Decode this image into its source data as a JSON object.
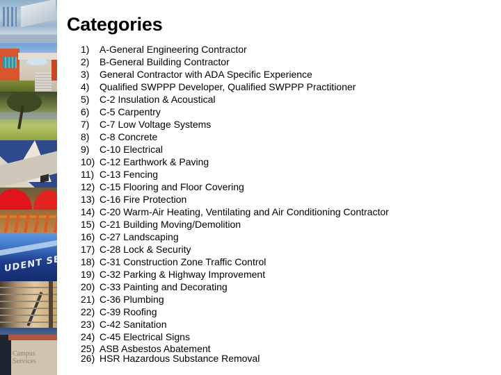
{
  "slide": {
    "title": "Categories",
    "photo_strip": [
      {
        "name": "glass-building-photo"
      },
      {
        "name": "orange-building-photo"
      },
      {
        "name": "trees-lawn-photo"
      },
      {
        "name": "white-tent-roof-photo"
      },
      {
        "name": "red-umbrellas-photo"
      },
      {
        "name": "services-sign-photo",
        "text": "UDENT SERVICES"
      },
      {
        "name": "stair-railing-photo"
      },
      {
        "name": "campus-services-building-photo",
        "text": "Campus Services"
      }
    ],
    "items": [
      {
        "num": "1)",
        "text": "A-General Engineering Contractor"
      },
      {
        "num": "2)",
        "text": "B-General Building Contractor"
      },
      {
        "num": "3)",
        "text": "General Contractor with ADA Specific Experience"
      },
      {
        "num": "4)",
        "text": "Qualified SWPPP Developer, Qualified SWPPP Practitioner"
      },
      {
        "num": "5)",
        "text": "C-2 Insulation & Acoustical"
      },
      {
        "num": "6)",
        "text": "C-5 Carpentry"
      },
      {
        "num": "7)",
        "text": "C-7 Low Voltage Systems"
      },
      {
        "num": "8)",
        "text": "C-8 Concrete"
      },
      {
        "num": "9)",
        "text": "C-10 Electrical"
      },
      {
        "num": "10)",
        "text": "C-12 Earthwork & Paving"
      },
      {
        "num": "11)",
        "text": "C-13 Fencing"
      },
      {
        "num": "12)",
        "text": "C-15 Flooring and Floor Covering"
      },
      {
        "num": "13)",
        "text": "C-16 Fire Protection"
      },
      {
        "num": "14)",
        "text": "C-20 Warm-Air Heating, Ventilating and Air Conditioning Contractor"
      },
      {
        "num": "15)",
        "text": "C-21 Building Moving/Demolition"
      },
      {
        "num": "16)",
        "text": "C-27 Landscaping"
      },
      {
        "num": "17)",
        "text": "C-28 Lock & Security"
      },
      {
        "num": "18)",
        "text": "C-31 Construction Zone Traffic Control"
      },
      {
        "num": "19)",
        "text": "C-32 Parking & Highway Improvement"
      },
      {
        "num": "20)",
        "text": "C-33 Painting and Decorating"
      },
      {
        "num": "21)",
        "text": "C-36 Plumbing"
      },
      {
        "num": "22)",
        "text": "C-39 Roofing"
      },
      {
        "num": "23)",
        "text": "C-42 Sanitation"
      },
      {
        "num": "24)",
        "text": "C-45 Electrical Signs"
      },
      {
        "num": "25)",
        "text": "ASB Asbestos Abatement"
      },
      {
        "num": "26)",
        "text": "HSR Hazardous Substance Removal"
      }
    ]
  }
}
